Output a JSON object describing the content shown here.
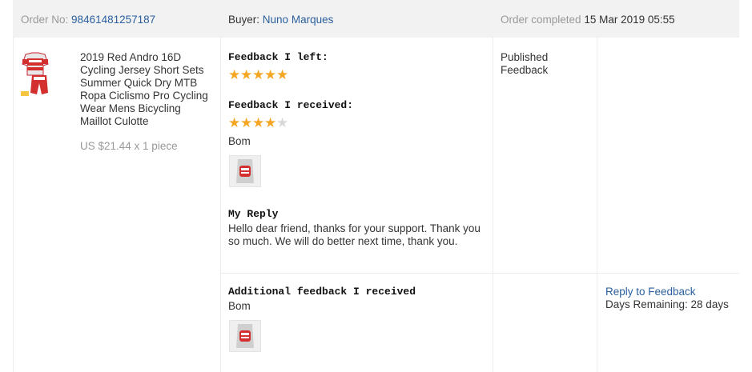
{
  "header": {
    "order_no_label": "Order No:",
    "order_no": "98461481257187",
    "buyer_label": "Buyer:",
    "buyer_name": "Nuno Marques",
    "completed_label": "Order completed",
    "completed_date": "15 Mar 2019 05:55"
  },
  "product": {
    "title": "2019 Red Andro 16D Cycling Jersey Short Sets Summer Quick Dry MTB Ropa Ciclismo Pro Cycling Wear Mens Bicycling Maillot Culotte",
    "price": "US $21.44 x 1 piece"
  },
  "feedback": {
    "left_label": "Feedback I left:",
    "left_rating": 5,
    "received_label": "Feedback I received:",
    "received_rating": 4,
    "received_text": "Bom",
    "reply_label": "My Reply",
    "reply_text": "Hello dear friend, thanks for your support. Thank you so much. We will do better next time, thank you."
  },
  "status": {
    "line1": "Published",
    "line2": "Feedback"
  },
  "additional": {
    "label": "Additional feedback I received",
    "text": "Bom",
    "reply_link": "Reply to Feedback",
    "days_remaining": "Days Remaining: 28 days"
  },
  "icons": {
    "star": "star-icon",
    "jersey": "cycling-jersey-image",
    "photo": "buyer-photo-thumbnail"
  },
  "colors": {
    "star_on": "#f5a623",
    "star_off": "#d9d9d9",
    "link": "#2b5f9e",
    "header_bg": "#f2f2f2"
  }
}
